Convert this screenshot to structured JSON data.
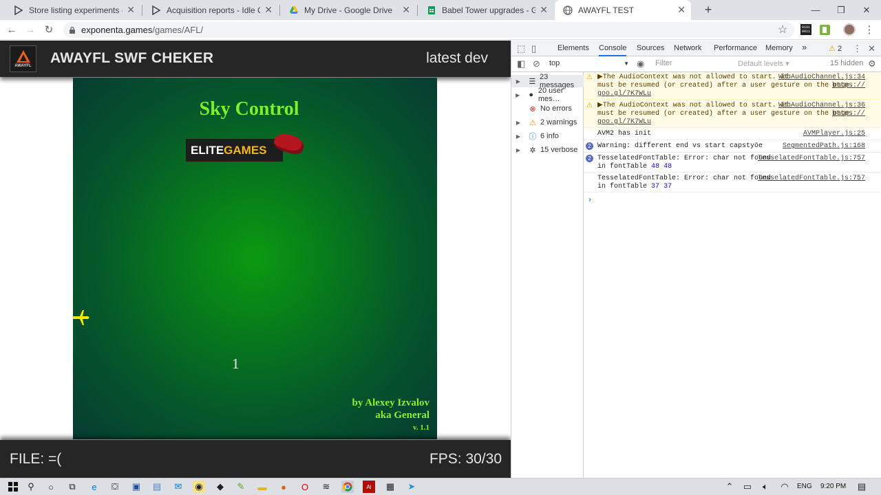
{
  "browser": {
    "tabs": [
      {
        "title": "Store listing experiments - Idle Coin Fa",
        "favicon": "play-console-icon"
      },
      {
        "title": "Acquisition reports - Idle Coin Fa",
        "favicon": "play-console-icon"
      },
      {
        "title": "My Drive - Google Drive",
        "favicon": "google-drive-icon"
      },
      {
        "title": "Babel Tower upgrades - Google S",
        "favicon": "google-sheets-icon"
      },
      {
        "title": "AWAYFL TEST",
        "favicon": "globe-icon"
      }
    ],
    "new_tab_symbol": "+",
    "window_controls": {
      "minimize": "—",
      "maximize": "❐",
      "close": "✕"
    },
    "url_host": "exponenta.games",
    "url_path": "/games/AFL/",
    "extension_label": "0101\n0011"
  },
  "app": {
    "logo_text": "AWAYFL",
    "title": "AWAYFL SWF CHEKER",
    "version": "latest dev",
    "game": {
      "title": "Sky Control",
      "sponsor_part1": "ELITE",
      "sponsor_part2": "GAMES",
      "counter": "1",
      "credits_line1": "by Alexey Izvalov",
      "credits_line2": "aka General",
      "credits_version": "v. 1.1"
    },
    "file_label": "FILE: =(",
    "fps_label": "FPS: 30/30"
  },
  "devtools": {
    "tabs": [
      "Elements",
      "Console",
      "Sources",
      "Network",
      "Performance",
      "Memory"
    ],
    "more_tabs": "»",
    "warning_count": "2",
    "context": "top",
    "filter_placeholder": "Filter",
    "levels": "Default levels ▾",
    "hidden": "15 hidden",
    "sidebar": [
      {
        "label": "23 messages",
        "icon": "list-icon"
      },
      {
        "label": "20 user mes…",
        "icon": "user-icon"
      },
      {
        "label": "No errors",
        "icon": "error-icon"
      },
      {
        "label": "2 warnings",
        "icon": "warning-icon"
      },
      {
        "label": "6 info",
        "icon": "info-icon"
      },
      {
        "label": "15 verbose",
        "icon": "verbose-icon"
      }
    ],
    "messages": [
      {
        "text1": "▶The AudioContext was not allowed to start. It",
        "text2": "must be resumed (or created) after a user gesture on the page.",
        "link_url": "https://",
        "link_url2": "goo.gl/7K7WLu",
        "source": "WebAudioChannel.js:34"
      },
      {
        "text1": "▶The AudioContext was not allowed to start. It",
        "text2": "must be resumed (or created) after a user gesture on the page.",
        "link_url": "https://",
        "link_url2": "goo.gl/7K7WLu",
        "source": "WebAudioChannel.js:36"
      },
      {
        "text1": "AVM2 has init",
        "source": "AVMPlayer.js:25"
      },
      {
        "count": "2",
        "text1": "Warning: different end vs start capstyöe",
        "source": "SegmentedPath.js:168"
      },
      {
        "count": "2",
        "text1": "TesselatedFontTable: Error: char not found",
        "text2": "in fontTable",
        "n1": "48",
        "n2": "48",
        "source": "TesselatedFontTable.js:757"
      },
      {
        "text1": "TesselatedFontTable: Error: char not found",
        "text2": "in fontTable",
        "n1": "37",
        "n2": "37",
        "source": "TesselatedFontTable.js:757"
      }
    ],
    "prompt": "›"
  },
  "taskbar": {
    "language": "ENG",
    "time": "9:20 PM"
  },
  "colors": {
    "game_green": "#7cf02a",
    "elite_gold": "#f6b71a",
    "header_bg": "#262626",
    "devtools_accent": "#1a73e8"
  }
}
